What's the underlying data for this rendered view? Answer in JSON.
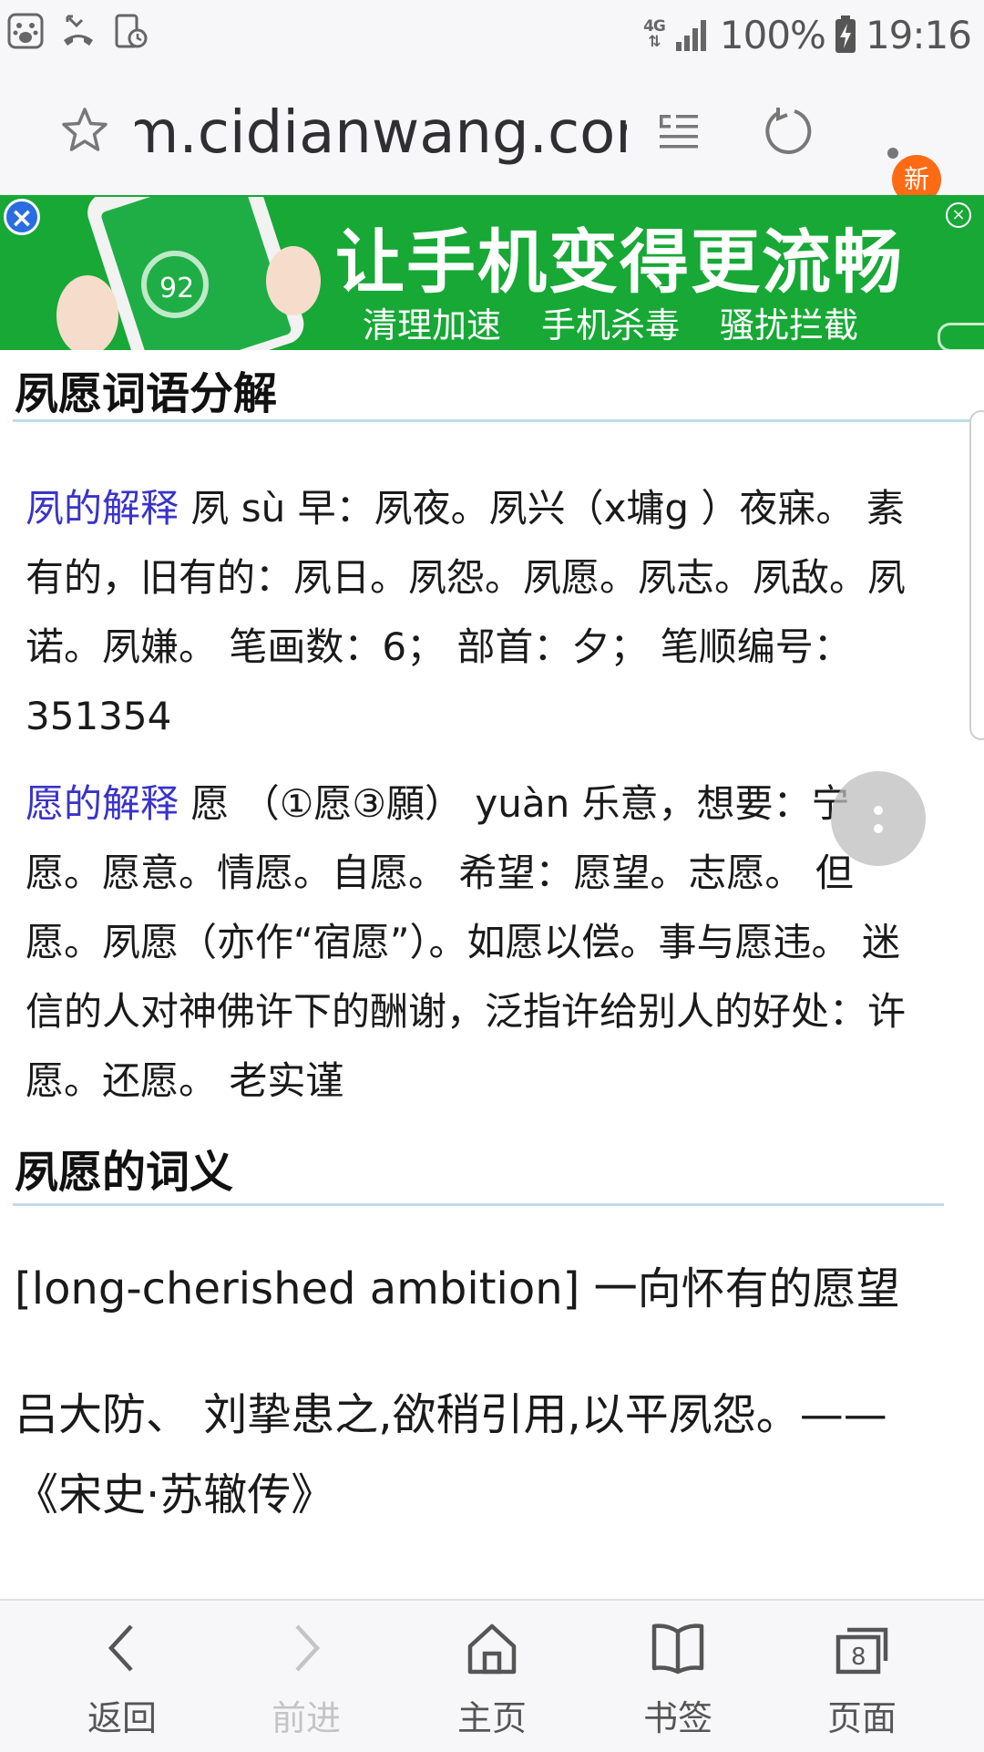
{
  "status_bar": {
    "network": "4G",
    "battery": "100%",
    "time": "19:16"
  },
  "url_bar": {
    "url": "m.cidianwang.com",
    "badge": "新"
  },
  "ad": {
    "headline": "让手机变得更流畅",
    "subs": [
      "清理加速",
      "手机杀毒",
      "骚扰拦截"
    ],
    "phone_score": "92"
  },
  "content": {
    "section1_title": "夙愿词语分解",
    "para1": {
      "link": "夙的解释",
      "lines": [
        " 夙 sù 早：夙夜。夙兴（x墉g ）夜寐。 素",
        "有的，旧有的：夙日。夙怨。夙愿。夙志。夙敌。夙",
        "诺。夙嫌。 笔画数：6； 部首：夕； 笔顺编号：",
        "351354"
      ]
    },
    "para2": {
      "link": "愿的解释",
      "lines": [
        " 愿 （①愿③願） yuàn 乐意，想要：宁",
        "愿。愿意。情愿。自愿。 希望：愿望。志愿。 但",
        "愿。夙愿（亦作“宿愿”）。如愿以偿。事与愿违。 迷",
        "信的人对神佛许下的酬谢，泛指许给别人的好处：许",
        "愿。还愿。 老实谨"
      ]
    },
    "section2_title": "夙愿的词义",
    "definition": "[long-cherished ambition] 一向怀有的愿望",
    "quote_lines": [
      "吕大防、 刘挚患之,欲稍引用,以平夙怨。——",
      "《宋史·苏辙传》"
    ]
  },
  "bottom_nav": {
    "back": "返回",
    "forward": "前进",
    "home": "主页",
    "bookmarks": "书签",
    "tabs": "页面",
    "tab_count": "8"
  },
  "colors": {
    "link": "#3a33c9",
    "ad_green": "#17a836",
    "badge_orange": "#ff6a14"
  }
}
